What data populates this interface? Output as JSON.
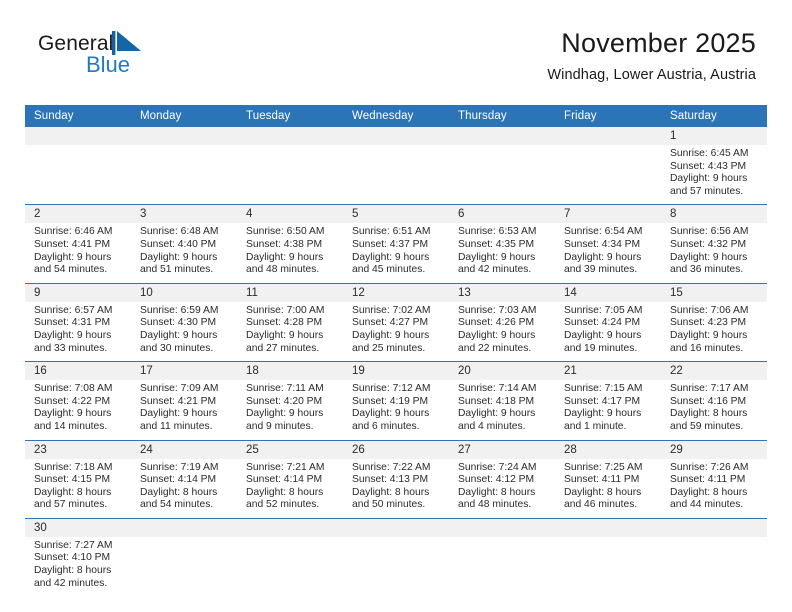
{
  "brand": {
    "name_part1": "General",
    "name_part2": "Blue",
    "mark_icon": "triangle-logo-icon",
    "accent_color": "#1f7ac4"
  },
  "header": {
    "title": "November 2025",
    "subtitle": "Windhag, Lower Austria, Austria"
  },
  "theme": {
    "header_bg": "#2b74b8",
    "daynum_bg": "#f1f1f1",
    "row_separator": "#2b74b8",
    "text": "#2b2b2b"
  },
  "weekdays": [
    "Sunday",
    "Monday",
    "Tuesday",
    "Wednesday",
    "Thursday",
    "Friday",
    "Saturday"
  ],
  "weeks": [
    [
      {
        "day": "",
        "blank": true
      },
      {
        "day": "",
        "blank": true
      },
      {
        "day": "",
        "blank": true
      },
      {
        "day": "",
        "blank": true
      },
      {
        "day": "",
        "blank": true
      },
      {
        "day": "",
        "blank": true
      },
      {
        "day": "1",
        "sunrise": "Sunrise: 6:45 AM",
        "sunset": "Sunset: 4:43 PM",
        "daylight1": "Daylight: 9 hours",
        "daylight2": "and 57 minutes."
      }
    ],
    [
      {
        "day": "2",
        "sunrise": "Sunrise: 6:46 AM",
        "sunset": "Sunset: 4:41 PM",
        "daylight1": "Daylight: 9 hours",
        "daylight2": "and 54 minutes."
      },
      {
        "day": "3",
        "sunrise": "Sunrise: 6:48 AM",
        "sunset": "Sunset: 4:40 PM",
        "daylight1": "Daylight: 9 hours",
        "daylight2": "and 51 minutes."
      },
      {
        "day": "4",
        "sunrise": "Sunrise: 6:50 AM",
        "sunset": "Sunset: 4:38 PM",
        "daylight1": "Daylight: 9 hours",
        "daylight2": "and 48 minutes."
      },
      {
        "day": "5",
        "sunrise": "Sunrise: 6:51 AM",
        "sunset": "Sunset: 4:37 PM",
        "daylight1": "Daylight: 9 hours",
        "daylight2": "and 45 minutes."
      },
      {
        "day": "6",
        "sunrise": "Sunrise: 6:53 AM",
        "sunset": "Sunset: 4:35 PM",
        "daylight1": "Daylight: 9 hours",
        "daylight2": "and 42 minutes."
      },
      {
        "day": "7",
        "sunrise": "Sunrise: 6:54 AM",
        "sunset": "Sunset: 4:34 PM",
        "daylight1": "Daylight: 9 hours",
        "daylight2": "and 39 minutes."
      },
      {
        "day": "8",
        "sunrise": "Sunrise: 6:56 AM",
        "sunset": "Sunset: 4:32 PM",
        "daylight1": "Daylight: 9 hours",
        "daylight2": "and 36 minutes."
      }
    ],
    [
      {
        "day": "9",
        "sunrise": "Sunrise: 6:57 AM",
        "sunset": "Sunset: 4:31 PM",
        "daylight1": "Daylight: 9 hours",
        "daylight2": "and 33 minutes."
      },
      {
        "day": "10",
        "sunrise": "Sunrise: 6:59 AM",
        "sunset": "Sunset: 4:30 PM",
        "daylight1": "Daylight: 9 hours",
        "daylight2": "and 30 minutes."
      },
      {
        "day": "11",
        "sunrise": "Sunrise: 7:00 AM",
        "sunset": "Sunset: 4:28 PM",
        "daylight1": "Daylight: 9 hours",
        "daylight2": "and 27 minutes."
      },
      {
        "day": "12",
        "sunrise": "Sunrise: 7:02 AM",
        "sunset": "Sunset: 4:27 PM",
        "daylight1": "Daylight: 9 hours",
        "daylight2": "and 25 minutes."
      },
      {
        "day": "13",
        "sunrise": "Sunrise: 7:03 AM",
        "sunset": "Sunset: 4:26 PM",
        "daylight1": "Daylight: 9 hours",
        "daylight2": "and 22 minutes."
      },
      {
        "day": "14",
        "sunrise": "Sunrise: 7:05 AM",
        "sunset": "Sunset: 4:24 PM",
        "daylight1": "Daylight: 9 hours",
        "daylight2": "and 19 minutes."
      },
      {
        "day": "15",
        "sunrise": "Sunrise: 7:06 AM",
        "sunset": "Sunset: 4:23 PM",
        "daylight1": "Daylight: 9 hours",
        "daylight2": "and 16 minutes."
      }
    ],
    [
      {
        "day": "16",
        "sunrise": "Sunrise: 7:08 AM",
        "sunset": "Sunset: 4:22 PM",
        "daylight1": "Daylight: 9 hours",
        "daylight2": "and 14 minutes."
      },
      {
        "day": "17",
        "sunrise": "Sunrise: 7:09 AM",
        "sunset": "Sunset: 4:21 PM",
        "daylight1": "Daylight: 9 hours",
        "daylight2": "and 11 minutes."
      },
      {
        "day": "18",
        "sunrise": "Sunrise: 7:11 AM",
        "sunset": "Sunset: 4:20 PM",
        "daylight1": "Daylight: 9 hours",
        "daylight2": "and 9 minutes."
      },
      {
        "day": "19",
        "sunrise": "Sunrise: 7:12 AM",
        "sunset": "Sunset: 4:19 PM",
        "daylight1": "Daylight: 9 hours",
        "daylight2": "and 6 minutes."
      },
      {
        "day": "20",
        "sunrise": "Sunrise: 7:14 AM",
        "sunset": "Sunset: 4:18 PM",
        "daylight1": "Daylight: 9 hours",
        "daylight2": "and 4 minutes."
      },
      {
        "day": "21",
        "sunrise": "Sunrise: 7:15 AM",
        "sunset": "Sunset: 4:17 PM",
        "daylight1": "Daylight: 9 hours",
        "daylight2": "and 1 minute."
      },
      {
        "day": "22",
        "sunrise": "Sunrise: 7:17 AM",
        "sunset": "Sunset: 4:16 PM",
        "daylight1": "Daylight: 8 hours",
        "daylight2": "and 59 minutes."
      }
    ],
    [
      {
        "day": "23",
        "sunrise": "Sunrise: 7:18 AM",
        "sunset": "Sunset: 4:15 PM",
        "daylight1": "Daylight: 8 hours",
        "daylight2": "and 57 minutes."
      },
      {
        "day": "24",
        "sunrise": "Sunrise: 7:19 AM",
        "sunset": "Sunset: 4:14 PM",
        "daylight1": "Daylight: 8 hours",
        "daylight2": "and 54 minutes."
      },
      {
        "day": "25",
        "sunrise": "Sunrise: 7:21 AM",
        "sunset": "Sunset: 4:14 PM",
        "daylight1": "Daylight: 8 hours",
        "daylight2": "and 52 minutes."
      },
      {
        "day": "26",
        "sunrise": "Sunrise: 7:22 AM",
        "sunset": "Sunset: 4:13 PM",
        "daylight1": "Daylight: 8 hours",
        "daylight2": "and 50 minutes."
      },
      {
        "day": "27",
        "sunrise": "Sunrise: 7:24 AM",
        "sunset": "Sunset: 4:12 PM",
        "daylight1": "Daylight: 8 hours",
        "daylight2": "and 48 minutes."
      },
      {
        "day": "28",
        "sunrise": "Sunrise: 7:25 AM",
        "sunset": "Sunset: 4:11 PM",
        "daylight1": "Daylight: 8 hours",
        "daylight2": "and 46 minutes."
      },
      {
        "day": "29",
        "sunrise": "Sunrise: 7:26 AM",
        "sunset": "Sunset: 4:11 PM",
        "daylight1": "Daylight: 8 hours",
        "daylight2": "and 44 minutes."
      }
    ],
    [
      {
        "day": "30",
        "sunrise": "Sunrise: 7:27 AM",
        "sunset": "Sunset: 4:10 PM",
        "daylight1": "Daylight: 8 hours",
        "daylight2": "and 42 minutes."
      },
      {
        "day": "",
        "blank": true
      },
      {
        "day": "",
        "blank": true
      },
      {
        "day": "",
        "blank": true
      },
      {
        "day": "",
        "blank": true
      },
      {
        "day": "",
        "blank": true
      },
      {
        "day": "",
        "blank": true
      }
    ]
  ]
}
